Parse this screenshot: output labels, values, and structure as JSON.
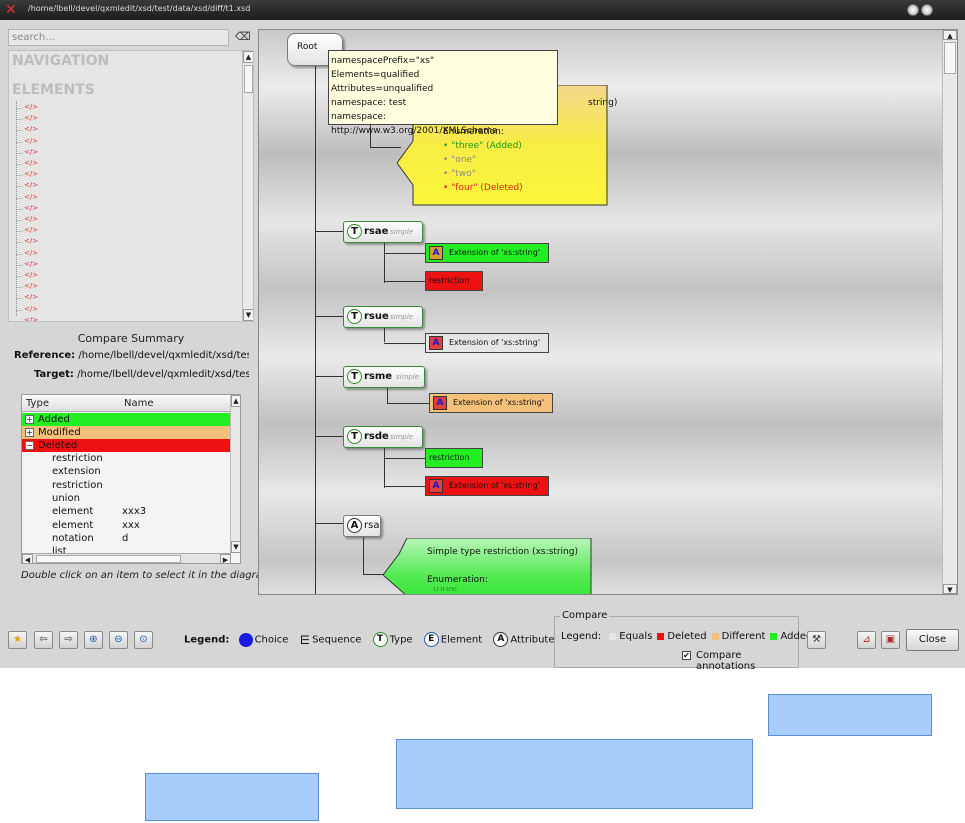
{
  "window": {
    "title": "/home/lbell/devel/qxmledit/xsd/test/data/xsd/diff/t1.xsd"
  },
  "left_panel": {
    "search_placeholder": "search...",
    "navigation_label": "NAVIGATION",
    "elements_label": "ELEMENTS",
    "nav_items": [
      "</>",
      "</>",
      "</>",
      "</>",
      "</>",
      "</>",
      "</>",
      "</>",
      "</>",
      "</>",
      "</>",
      "</>",
      "</>",
      "</>",
      "</>",
      "</>",
      "</>",
      "</>",
      "</>",
      "</>"
    ]
  },
  "compare_summary": {
    "title": "Compare Summary",
    "reference_label": "Reference:",
    "reference_path": "/home/lbell/devel/qxmledit/xsd/test/da",
    "target_label": "Target:",
    "target_path": "/home/lbell/devel/qxmledit/xsd/test/da",
    "columns": [
      "Type",
      "Name"
    ],
    "groups": [
      {
        "label": "Added",
        "color": "#22ee22"
      },
      {
        "label": "Modified",
        "color": "#f5c07a"
      },
      {
        "label": "Deleted",
        "color": "#ee1111"
      }
    ],
    "rows": [
      {
        "type": "restriction",
        "name": ""
      },
      {
        "type": "extension",
        "name": ""
      },
      {
        "type": "restriction",
        "name": ""
      },
      {
        "type": "union",
        "name": ""
      },
      {
        "type": "element",
        "name": "xxx3"
      },
      {
        "type": "element",
        "name": "xxx"
      },
      {
        "type": "notation",
        "name": "d"
      },
      {
        "type": "list",
        "name": ""
      }
    ],
    "hint": "Double click on an item to select it in the diagram"
  },
  "diagram": {
    "root_label": "Root",
    "tooltip_lines": [
      "namespacePrefix=\"xs\"",
      "Elements=qualified",
      "Attributes=unqualified",
      "namespace: test",
      "namespace: http://www.w3.org/2001/XMLSchema"
    ],
    "top_annotation": {
      "header_tail": "string)",
      "enum_label": "Enumeration:",
      "values": [
        {
          "text": "\"three\" (Added)",
          "color": "#1e9a1e"
        },
        {
          "text": "\"one\"",
          "color": "#8a8a8a"
        },
        {
          "text": "\"two\"",
          "color": "#8a8a8a"
        },
        {
          "text": "\"four\" (Deleted)",
          "color": "#dd2222"
        }
      ]
    },
    "types": [
      {
        "name": "rsae",
        "kind": "simple",
        "children": [
          {
            "label": "Extension of 'xs:string'",
            "color": "#22ee22",
            "badge": "A"
          },
          {
            "label": "restriction",
            "color": "#ee1111",
            "badge": ""
          }
        ]
      },
      {
        "name": "rsue",
        "kind": "simple",
        "children": [
          {
            "label": "Extension of 'xs:string'",
            "color": "#e6e6e6",
            "badge": "A"
          }
        ]
      },
      {
        "name": "rsme",
        "kind": "simple",
        "children": [
          {
            "label": "Extension of 'xs:string'",
            "color": "#f5c07a",
            "badge": "A"
          }
        ]
      },
      {
        "name": "rsde",
        "kind": "simple",
        "children": [
          {
            "label": "restriction",
            "color": "#22ee22",
            "badge": ""
          },
          {
            "label": "Extension of 'xs:string'",
            "color": "#ee1111",
            "badge": "A"
          }
        ]
      }
    ],
    "attribute": {
      "letter": "A",
      "name": "rsa",
      "annotation_title": "Simple type restriction (xs:string)",
      "annotation_enum": "Enumeration:",
      "annotation_cut": "\"three\""
    }
  },
  "toolbar": {
    "legend_label": "Legend:",
    "legend_items": [
      {
        "label": "Choice",
        "symbol": "●"
      },
      {
        "label": "Sequence",
        "symbol": "E"
      },
      {
        "label": "Type",
        "symbol": "T"
      },
      {
        "label": "Element",
        "symbol": "E"
      },
      {
        "label": "Attribute",
        "symbol": "A"
      }
    ],
    "compare_box_label": "Compare",
    "compare_legend": "Legend:",
    "compare_items": [
      {
        "label": "Equals",
        "color": "#e6e6e6"
      },
      {
        "label": "Deleted",
        "color": "#ee1111"
      },
      {
        "label": "Different",
        "color": "#f5c07a"
      },
      {
        "label": "Added",
        "color": "#22ee22"
      }
    ],
    "compare_annotations_label": "Compare annotations",
    "compare_annotations_checked": true,
    "close_label": "Close"
  }
}
